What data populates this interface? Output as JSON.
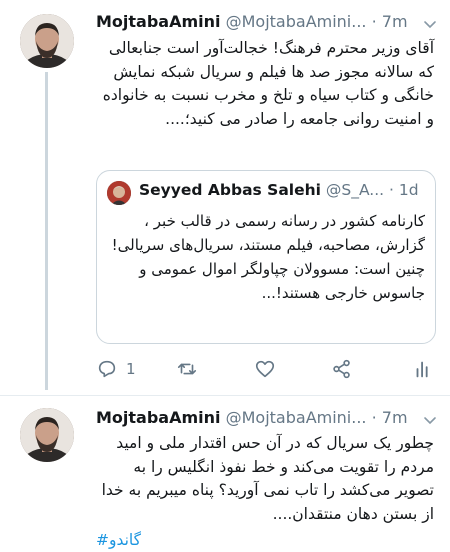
{
  "tweets": [
    {
      "name": "MojtabaAmini",
      "handle": "@MojtabaAmini...",
      "dot": "·",
      "time": "7m",
      "text": "آقای وزیر محترم فرهنگ! خجالت‌آور است جنابعالی که سالانه مجوز صد ها فیلم و سریال شبکه نمایش خانگی و کتاب سیاه و تلخ و مخرب نسبت به خانواده و امنیت روانی جامعه را صادر می کنید؛...."
    },
    {
      "name": "MojtabaAmini",
      "handle": "@MojtabaAmini...",
      "dot": "·",
      "time": "7m",
      "text": "چطور یک سریال که در آن حس اقتدار ملی و امید مردم را تقویت می‌کند و خط نفوذ انگلیس را به تصویر می‌کشد را تاب نمی آورید؟ پناه میبریم به خدا از بستن دهان منتقدان....",
      "hashtag": "#گاندو"
    }
  ],
  "quoted": {
    "name": "Seyyed Abbas Salehi",
    "handle": "@S_A...",
    "dot": "·",
    "time": "1d",
    "text": "کارنامه کشور در رسانه رسمی در قالب خبر ، گزارش، مصاحبه، فیلم مستند، سریال‌های سریالی! چنین است: مسوولان چپاولگر اموال عمومی و جاسوس خارجی هستند!..."
  },
  "actions": {
    "reply_count": "1",
    "icons": [
      "reply-icon",
      "retweet-icon",
      "like-icon",
      "share-icon",
      "analytics-icon"
    ]
  },
  "colors": {
    "text": "#14171a",
    "secondary": "#657786",
    "link": "#1b95e0",
    "border": "#e6ecf0"
  }
}
